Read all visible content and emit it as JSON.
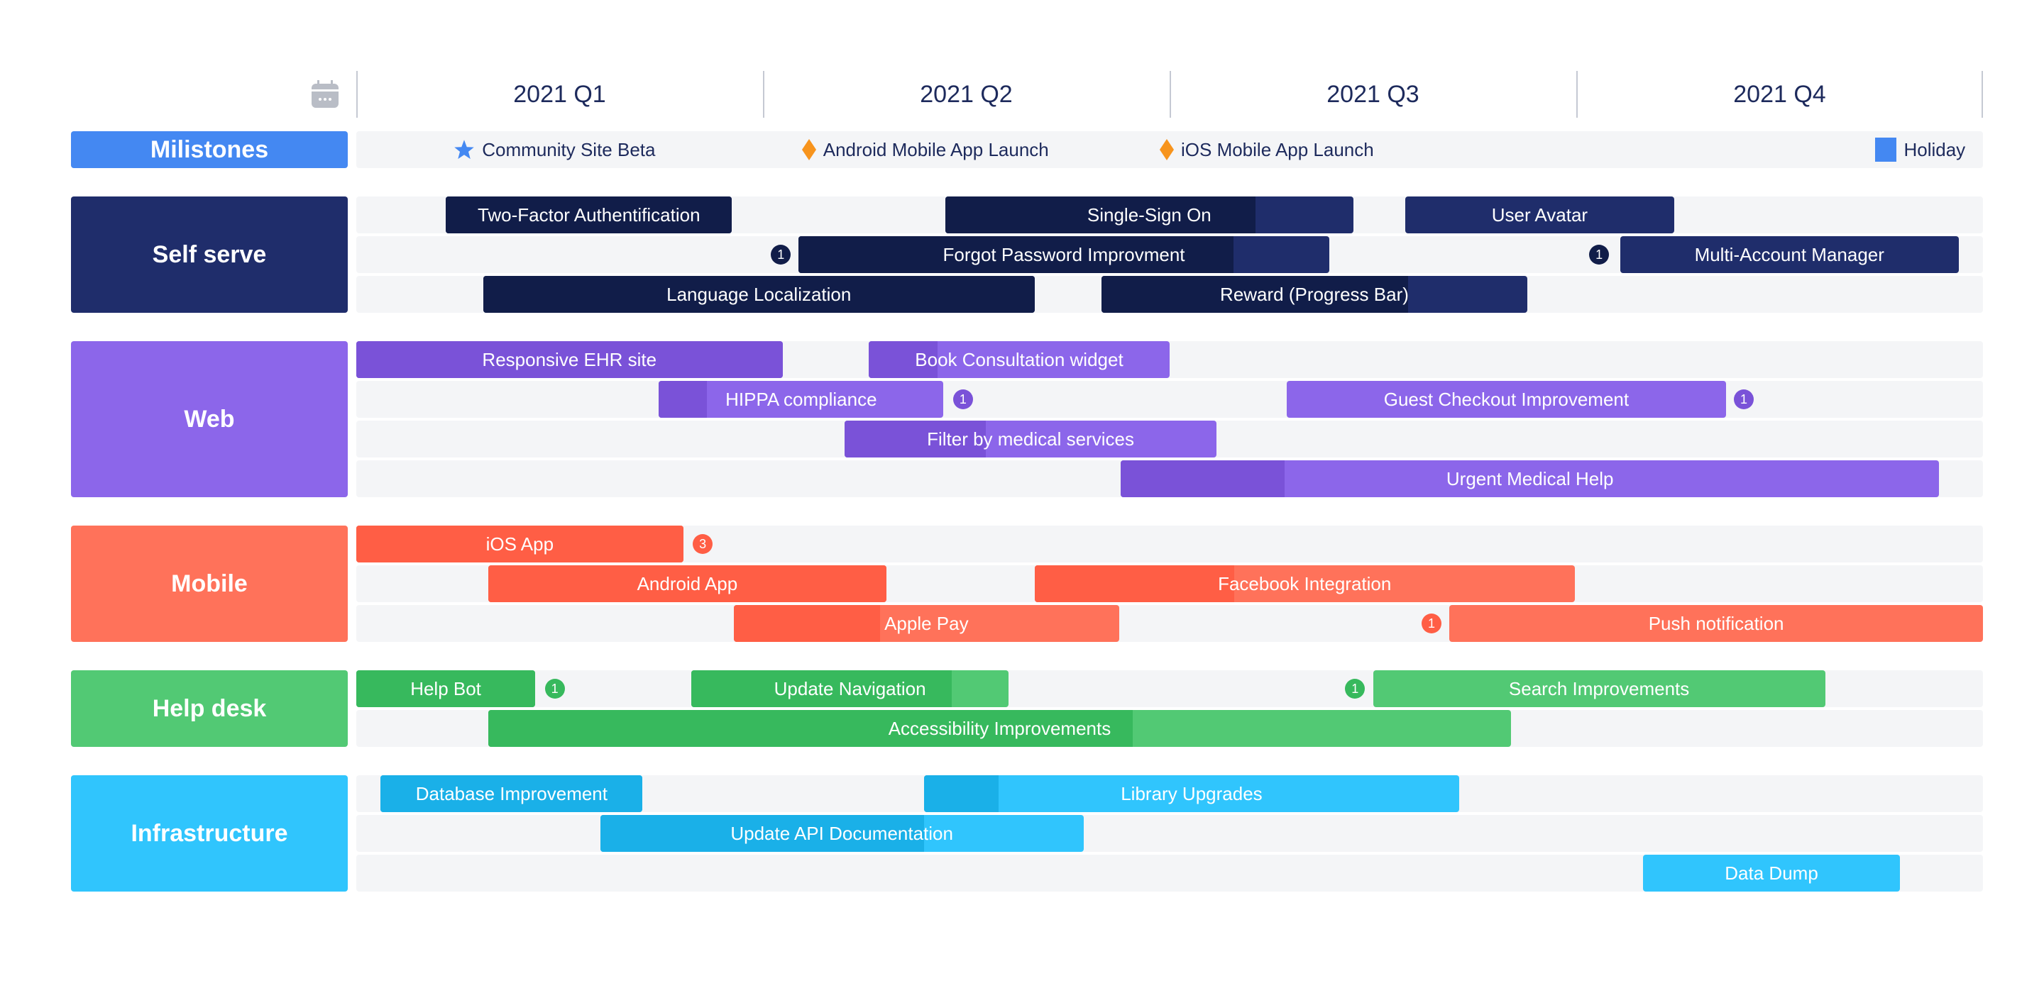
{
  "header": {
    "calendar_icon": "calendar-icon",
    "quarters": [
      "2021 Q1",
      "2021 Q2",
      "2021 Q3",
      "2021 Q4"
    ]
  },
  "milestones": {
    "label": "Milistones",
    "color": "#4488f2",
    "items": [
      {
        "label": "Community Site Beta",
        "icon": "star-icon",
        "color": "#4488f2",
        "at": 0.066
      },
      {
        "label": "Android Mobile App Launch",
        "icon": "diamond-icon",
        "color": "#f7941d",
        "at": 0.28
      },
      {
        "label": "iOS Mobile App Launch",
        "icon": "diamond-icon",
        "color": "#f7941d",
        "at": 0.5
      },
      {
        "label": "Holiday",
        "icon": "square-icon",
        "color": "#4488f2",
        "at": 0.94
      }
    ]
  },
  "chart_data": {
    "type": "gantt",
    "title": "",
    "timeline": {
      "start": "2021 Q1",
      "end": "2021 Q4",
      "ticks": [
        "2021 Q1",
        "2021 Q2",
        "2021 Q3",
        "2021 Q4"
      ]
    },
    "groups": [
      {
        "name": "Self serve",
        "color": "#1f2d6b",
        "progress_color": "#111d49",
        "lanes": 3,
        "tasks": [
          {
            "label": "Two-Factor Authentification",
            "lane": 0,
            "start": 0.055,
            "end": 0.231,
            "progress": 1.0
          },
          {
            "label": "Single-Sign On",
            "lane": 0,
            "start": 0.362,
            "end": 0.613,
            "progress": 0.76
          },
          {
            "label": "User Avatar",
            "lane": 0,
            "start": 0.645,
            "end": 0.81,
            "progress": 0
          },
          {
            "label": "Forgot Password Improvment",
            "lane": 1,
            "start": 0.272,
            "end": 0.598,
            "progress": 0.82
          },
          {
            "label": "Multi-Account Manager",
            "lane": 1,
            "start": 0.777,
            "end": 0.985,
            "progress": 0
          },
          {
            "label": "Language Localization",
            "lane": 2,
            "start": 0.078,
            "end": 0.417,
            "progress": 1.0
          },
          {
            "label": "Reward (Progress Bar)",
            "lane": 2,
            "start": 0.458,
            "end": 0.72,
            "progress": 0.72
          }
        ],
        "badges": [
          {
            "text": "1",
            "lane": 1,
            "at": 0.261
          },
          {
            "text": "1",
            "lane": 1,
            "at": 0.764
          }
        ]
      },
      {
        "name": "Web",
        "color": "#8c66ea",
        "progress_color": "#7a52d8",
        "lanes": 4,
        "tasks": [
          {
            "label": "Responsive EHR site",
            "lane": 0,
            "start": 0.0,
            "end": 0.262,
            "progress": 1.0
          },
          {
            "label": "Book Consultation widget",
            "lane": 0,
            "start": 0.315,
            "end": 0.5,
            "progress": 0.23
          },
          {
            "label": "HIPPA compliance",
            "lane": 1,
            "start": 0.186,
            "end": 0.361,
            "progress": 0.17
          },
          {
            "label": "Guest Checkout Improvement",
            "lane": 1,
            "start": 0.572,
            "end": 0.842,
            "progress": 0
          },
          {
            "label": "Filter by medical services",
            "lane": 2,
            "start": 0.3,
            "end": 0.529,
            "progress": 0.38
          },
          {
            "label": "Urgent Medical Help",
            "lane": 3,
            "start": 0.47,
            "end": 0.973,
            "progress": 0.2
          }
        ],
        "badges": [
          {
            "text": "1",
            "lane": 1,
            "at": 0.373
          },
          {
            "text": "1",
            "lane": 1,
            "at": 0.853
          }
        ]
      },
      {
        "name": "Mobile",
        "color": "#ff725a",
        "progress_color": "#ff5e45",
        "lanes": 3,
        "tasks": [
          {
            "label": "iOS App",
            "lane": 0,
            "start": 0.0,
            "end": 0.201,
            "progress": 1.0
          },
          {
            "label": "Android App",
            "lane": 1,
            "start": 0.081,
            "end": 0.326,
            "progress": 1.0
          },
          {
            "label": "Facebook Integration",
            "lane": 1,
            "start": 0.417,
            "end": 0.749,
            "progress": 0.37
          },
          {
            "label": "Apple Pay",
            "lane": 2,
            "start": 0.232,
            "end": 0.469,
            "progress": 0.38
          },
          {
            "label": "Push notification",
            "lane": 2,
            "start": 0.672,
            "end": 1.0,
            "progress": 0
          }
        ],
        "badges": [
          {
            "text": "3",
            "lane": 0,
            "at": 0.213
          },
          {
            "text": "1",
            "lane": 2,
            "at": 0.661
          }
        ]
      },
      {
        "name": "Help desk",
        "color": "#52c974",
        "progress_color": "#37b95d",
        "lanes": 2,
        "tasks": [
          {
            "label": "Help Bot",
            "lane": 0,
            "start": 0.0,
            "end": 0.11,
            "progress": 1.0
          },
          {
            "label": "Update Navigation",
            "lane": 0,
            "start": 0.206,
            "end": 0.401,
            "progress": 0.82
          },
          {
            "label": "Search Improvements",
            "lane": 0,
            "start": 0.625,
            "end": 0.903,
            "progress": 0
          },
          {
            "label": "Accessibility Improvements",
            "lane": 1,
            "start": 0.081,
            "end": 0.71,
            "progress": 0.63
          }
        ],
        "badges": [
          {
            "text": "1",
            "lane": 0,
            "at": 0.122
          },
          {
            "text": "1",
            "lane": 0,
            "at": 0.614
          }
        ]
      },
      {
        "name": "Infrastructure",
        "color": "#30c5fd",
        "progress_color": "#1ab0e8",
        "lanes": 3,
        "tasks": [
          {
            "label": "Database Improvement",
            "lane": 0,
            "start": 0.015,
            "end": 0.176,
            "progress": 1.0
          },
          {
            "label": "Library Upgrades",
            "lane": 0,
            "start": 0.349,
            "end": 0.678,
            "progress": 0.14
          },
          {
            "label": "Update API Documentation",
            "lane": 1,
            "start": 0.15,
            "end": 0.447,
            "progress": 0.67
          },
          {
            "label": "Data Dump",
            "lane": 2,
            "start": 0.791,
            "end": 0.949,
            "progress": 0
          }
        ],
        "badges": []
      }
    ]
  }
}
